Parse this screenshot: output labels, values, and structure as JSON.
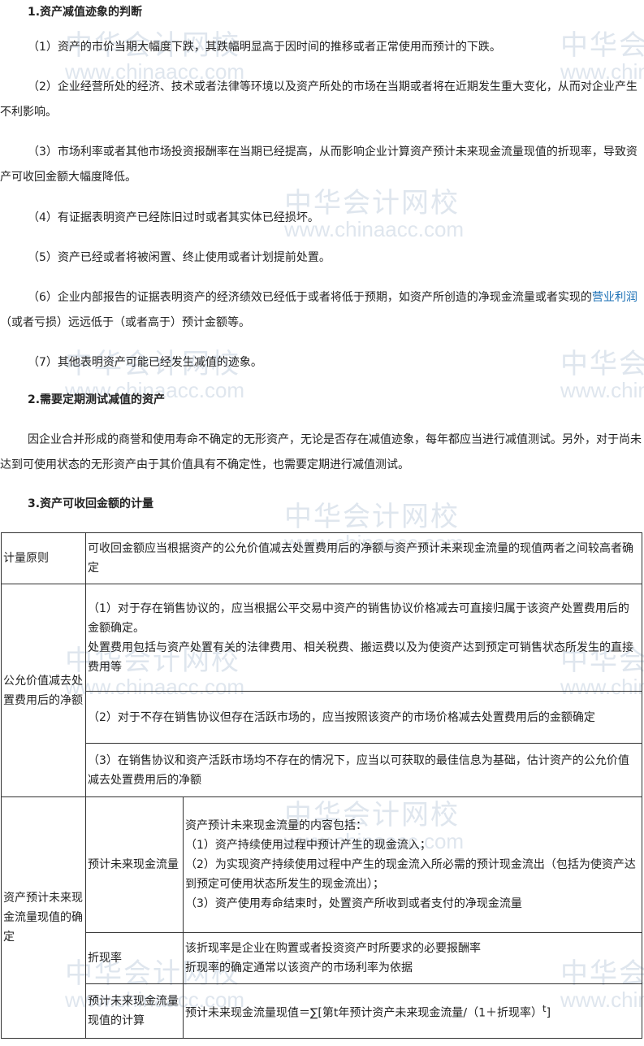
{
  "watermark": {
    "cn": "中华会计网校",
    "en": "www.chinaacc.com"
  },
  "s1": {
    "title": "1.资产减值迹象的判断",
    "items": [
      "（1）资产的市价当期大幅度下跌，其跌幅明显高于因时间的推移或者正常使用而预计的下跌。",
      "（2）企业经营所处的经济、技术或者法律等环境以及资产所处的市场在当期或者将在近期发生重大变化，从而对企业产生不利影响。",
      "（3）市场利率或者其他市场投资报酬率在当期已经提高，从而影响企业计算资产预计未来现金流量现值的折现率，导致资产可收回金额大幅度降低。",
      "（4）有证据表明资产已经陈旧过时或者其实体已经损坏。",
      "（5）资产已经或者将被闲置、终止使用或者计划提前处置。"
    ],
    "item6_a": "（6）企业内部报告的证据表明资产的经济绩效已经低于或者将低于预期，如资产所创造的净现金流量或者实现的",
    "item6_link": "营业利润",
    "item6_b": "（或者亏损）远远低于（或者高于）预计金额等。",
    "item7": "（7）其他表明资产可能已经发生减值的迹象。"
  },
  "s2": {
    "title": "2.需要定期测试减值的资产",
    "text": "因企业合并形成的商誉和使用寿命不确定的无形资产，无论是否存在减值迹象，每年都应当进行减值测试。另外，对于尚未达到可使用状态的无形资产由于其价值具有不确定性，也需要定期进行减值测试。"
  },
  "s3": {
    "title": "3.资产可收回金额的计量",
    "r1": {
      "label": "计量原则",
      "text": "可收回金额应当根据资产的公允价值减去处置费用后的净额与资产预计未来现金流量的现值两者之间较高者确定"
    },
    "r2": {
      "label": "公允价值减去处置费用后的净额",
      "a1": "（1）对于存在销售协议的，应当根据公平交易中资产的销售协议价格减去可直接归属于该资产处置费用后的金额确定。",
      "a2": "处置费用包括与资产处置有关的法律费用、相关税费、搬运费以及为使资产达到预定可销售状态所发生的直接费用等",
      "b": "（2）对于不存在销售协议但存在活跃市场的，应当按照该资产的市场价格减去处置费用后的金额确定",
      "c": "（3）在销售协议和资产活跃市场均不存在的情况下，应当以可获取的最佳信息为基础，估计资产的公允价值减去处置费用后的净额"
    },
    "r3": {
      "label": "资产预计未来现金流量现值的确定",
      "cf_label": "预计未来现金流量",
      "cf": [
        "资产预计未来现金流量的内容包括：",
        "（1）资产持续使用过程中预计产生的现金流入；",
        "（2）为实现资产持续使用过程中产生的现金流入所必需的预计现金流出（包括为使资产达到预定可使用状态所发生的现金流出）；",
        "（3）资产使用寿命结束时，处置资产所收到或者支付的净现金流量"
      ],
      "dr_label": "折现率",
      "dr": [
        "该折现率是企业在购置或者投资资产时所要求的必要报酬率",
        "折现率的确定通常以该资产的市场利率为依据"
      ],
      "pv_label": "预计未来现金流量现值的计算",
      "pv": "预计未来现金流量现值＝∑[第t年预计资产未来现金流量/（1＋折现率）",
      "pv_sup": "t",
      "pv_end": "]"
    }
  }
}
